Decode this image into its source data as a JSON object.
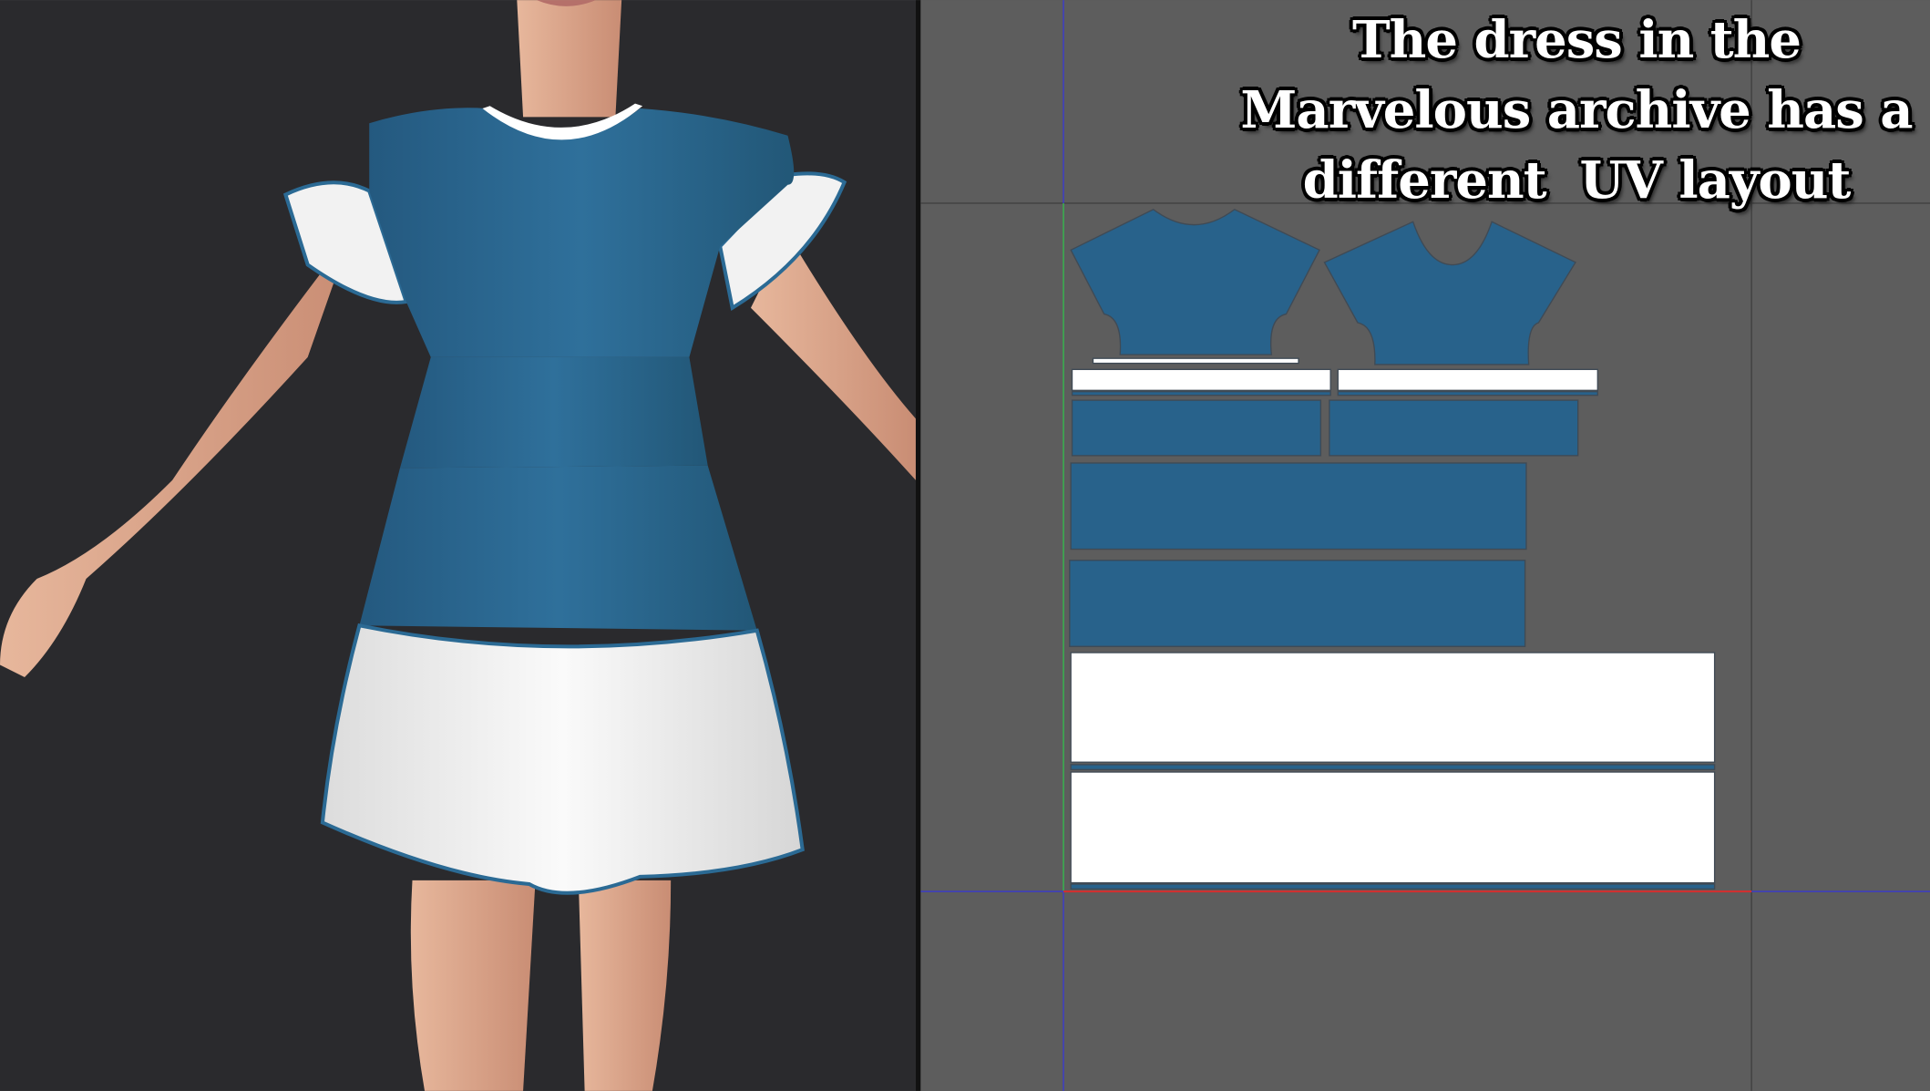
{
  "caption": {
    "lines": [
      "The dress in the",
      "Marvelous archive has a",
      "different  UV layout"
    ]
  },
  "viewport_3d": {
    "background": "#2a2a2d",
    "dress_color": "#2b6a94",
    "trim_color": "#ffffff"
  },
  "uv_editor": {
    "background": "#5d5d5d",
    "piece_blue": "#28628b",
    "piece_white": "#ffffff",
    "axis_u_color": "#d03030",
    "axis_v_color": "#3ac03a",
    "grid_line_color": "#3a3ad0"
  }
}
